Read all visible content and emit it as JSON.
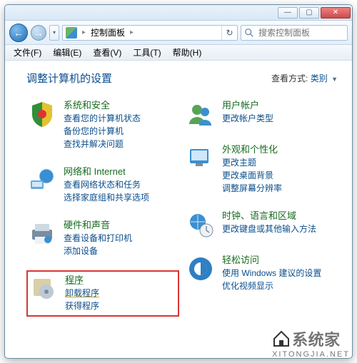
{
  "titlebar": {
    "minimize": "—",
    "maximize": "▢",
    "close": "✕"
  },
  "nav": {
    "back_glyph": "←",
    "fwd_glyph": "→",
    "dropdown_glyph": "▾",
    "breadcrumb_root": "控制面板",
    "breadcrumb_sep": "▸",
    "refresh_glyph": "↻"
  },
  "search": {
    "placeholder": "搜索控制面板"
  },
  "menubar": {
    "file": "文件(F)",
    "edit": "编辑(E)",
    "view": "查看(V)",
    "tools": "工具(T)",
    "help": "帮助(H)"
  },
  "heading": "调整计算机的设置",
  "viewby": {
    "label": "查看方式:",
    "value": "类别"
  },
  "categories": {
    "left": [
      {
        "title": "系统和安全",
        "links": [
          "查看您的计算机状态",
          "备份您的计算机",
          "查找并解决问题"
        ]
      },
      {
        "title": "网络和 Internet",
        "links": [
          "查看网络状态和任务",
          "选择家庭组和共享选项"
        ]
      },
      {
        "title": "硬件和声音",
        "links": [
          "查看设备和打印机",
          "添加设备"
        ]
      },
      {
        "title": "程序",
        "links": [
          "卸载程序",
          "获得程序"
        ],
        "highlight": true
      }
    ],
    "right": [
      {
        "title": "用户帐户",
        "links": [
          "更改帐户类型"
        ]
      },
      {
        "title": "外观和个性化",
        "links": [
          "更改主题",
          "更改桌面背景",
          "调整屏幕分辨率"
        ]
      },
      {
        "title": "时钟、语言和区域",
        "links": [
          "更改键盘或其他输入方法"
        ]
      },
      {
        "title": "轻松访问",
        "links": [
          "使用 Windows 建议的设置",
          "优化视频显示"
        ]
      }
    ]
  },
  "watermark": {
    "main": "系统家",
    "sub": "XITONGJIA.NET"
  }
}
